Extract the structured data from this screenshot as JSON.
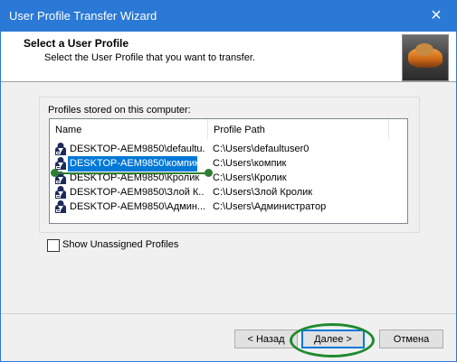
{
  "window": {
    "title": "User Profile Transfer Wizard",
    "close_glyph": "×"
  },
  "header": {
    "title": "Select a User Profile",
    "subtitle": "Select the User Profile that you want to transfer.",
    "thumbnail_icon": "profile-picture-icon"
  },
  "group": {
    "label": "Profiles stored on this computer:"
  },
  "list": {
    "columns": [
      "Name",
      "Profile Path"
    ],
    "rows": [
      {
        "name": "DESKTOP-AEM9850\\defaultu...",
        "path": "C:\\Users\\defaultuser0",
        "selected": false
      },
      {
        "name": "DESKTOP-AEM9850\\компик",
        "path": "C:\\Users\\компик",
        "selected": true
      },
      {
        "name": "DESKTOP-AEM9850\\Кролик",
        "path": "C:\\Users\\Кролик",
        "selected": false
      },
      {
        "name": "DESKTOP-AEM9850\\Злой К...",
        "path": "C:\\Users\\Злой Кролик",
        "selected": false
      },
      {
        "name": "DESKTOP-AEM9850\\Админ...",
        "path": "C:\\Users\\Администратор",
        "selected": false
      }
    ],
    "row_icon": "user-profile-icon"
  },
  "checkbox": {
    "label": "Show Unassigned Profiles",
    "checked": false
  },
  "buttons": {
    "back": "< Назад",
    "next": "Далее >",
    "cancel": "Отмена"
  },
  "colors": {
    "titlebar": "#2b79d6",
    "selection": "#0078d7",
    "annotation": "#1e8a2e"
  }
}
